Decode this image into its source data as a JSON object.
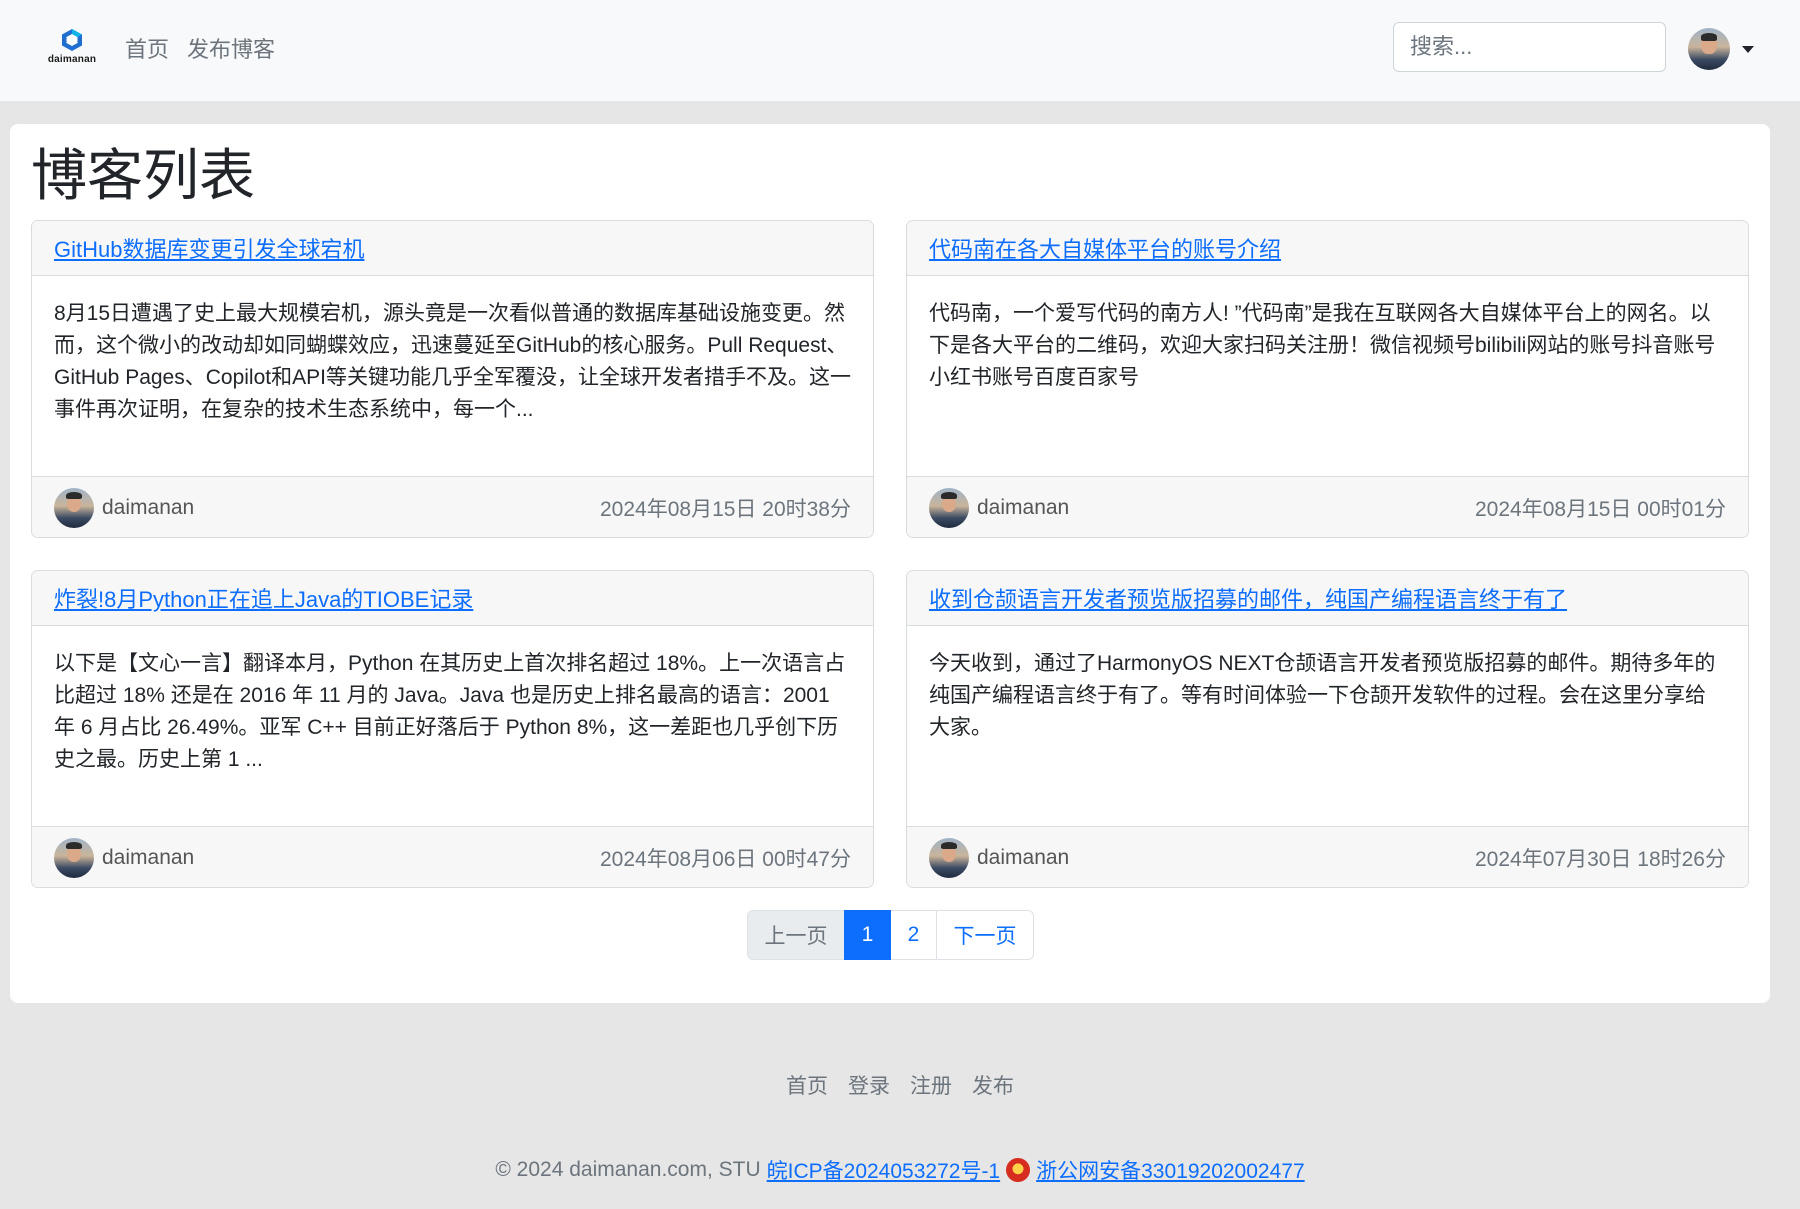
{
  "nav": {
    "logo_text": "daimanan",
    "links": [
      "首页",
      "发布博客"
    ],
    "search_placeholder": "搜索..."
  },
  "page": {
    "title": "博客列表"
  },
  "posts": [
    {
      "title": "GitHub数据库变更引发全球宕机",
      "summary": "8月15日遭遇了史上最大规模宕机，源头竟是一次看似普通的数据库基础设施变更。然而，这个微小的改动却如同蝴蝶效应，迅速蔓延至GitHub的核心服务。Pull Request、GitHub Pages、Copilot和API等关键功能几乎全军覆没，让全球开发者措手不及。这一事件再次证明，在复杂的技术生态系统中，每一个...",
      "author": "daimanan",
      "date": "2024年08月15日 20时38分"
    },
    {
      "title": "代码南在各大自媒体平台的账号介绍",
      "summary": "代码南，一个爱写代码的南方人! ”代码南”是我在互联网各大自媒体平台上的网名。以下是各大平台的二维码，欢迎大家扫码关注册！微信视频号bilibili网站的账号抖音账号小红书账号百度百家号",
      "author": "daimanan",
      "date": "2024年08月15日 00时01分"
    },
    {
      "title": "炸裂!8月Python正在追上Java的TIOBE记录",
      "summary": "以下是【文心一言】翻译本月，Python 在其历史上首次排名超过 18%。上一次语言占比超过 18% 还是在 2016 年 11 月的 Java。Java 也是历史上排名最高的语言：2001 年 6 月占比 26.49%。亚军 C++ 目前正好落后于 Python 8%，这一差距也几乎创下历史之最。历史上第 1 ...",
      "author": "daimanan",
      "date": "2024年08月06日 00时47分"
    },
    {
      "title": "收到仓颉语言开发者预览版招募的邮件，纯国产编程语言终于有了",
      "summary": "今天收到，通过了HarmonyOS NEXT仓颉语言开发者预览版招募的邮件。期待多年的纯国产编程语言终于有了。等有时间体验一下仓颉开发软件的过程。会在这里分享给大家。",
      "author": "daimanan",
      "date": "2024年07月30日 18时26分"
    }
  ],
  "pagination": {
    "prev": "上一页",
    "pages": [
      "1",
      "2"
    ],
    "active": "1",
    "next": "下一页"
  },
  "footer": {
    "links": [
      "首页",
      "登录",
      "注册",
      "发布"
    ],
    "copyright": "© 2024 daimanan.com, STU",
    "icp": "皖ICP备2024053272号-1",
    "police": "浙公网安备33019202002477"
  },
  "colors": {
    "primary": "#0d6efd",
    "navbar_bg": "#f8f9fa",
    "page_bg": "#e6e6e6"
  }
}
